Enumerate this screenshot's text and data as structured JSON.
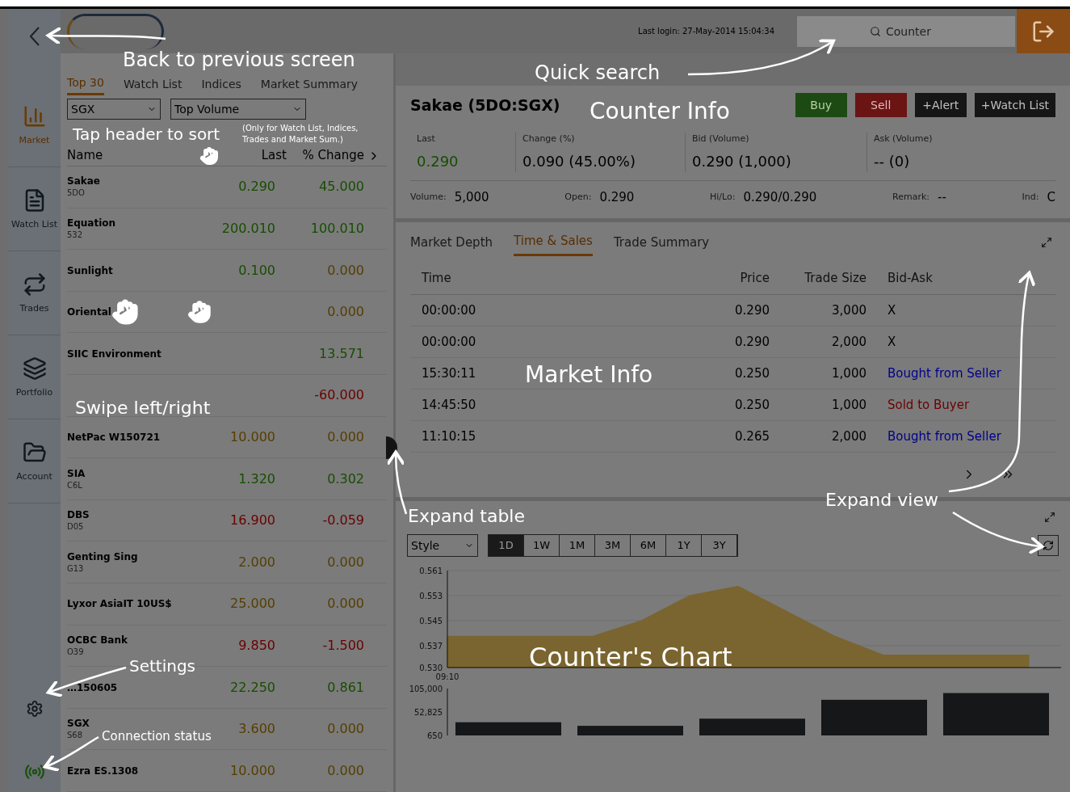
{
  "sidebar": {
    "items": [
      {
        "label": "Market",
        "kind": "market",
        "selected": true
      },
      {
        "label": "Watch List",
        "kind": "watchlist",
        "selected": false
      },
      {
        "label": "Trades",
        "kind": "trades",
        "selected": false
      },
      {
        "label": "Portfolio",
        "kind": "portfolio",
        "selected": false
      },
      {
        "label": "Account",
        "kind": "account",
        "selected": false
      }
    ]
  },
  "header": {
    "last_login": "Last login: 27-May-2014 15:04:34",
    "search": {
      "placeholder": "Counter"
    }
  },
  "watch_panel": {
    "tabs": [
      {
        "label": "Top 30",
        "selected": true
      },
      {
        "label": "Watch List",
        "selected": false
      },
      {
        "label": "Indices",
        "selected": false
      },
      {
        "label": "Market Summary",
        "selected": false
      }
    ],
    "exchange": "SGX",
    "sort": "Top Volume",
    "columns": [
      "Name",
      "Last",
      "% Change"
    ],
    "rows": [
      {
        "name": "Sakae",
        "code": "5DO",
        "last": {
          "text": "0.290",
          "color": "#174d00"
        },
        "change": {
          "text": "45.000",
          "color": "#174d00"
        }
      },
      {
        "name": "Equation",
        "code": "532",
        "last": {
          "text": "200.010",
          "color": "#174d00"
        },
        "change": {
          "text": "100.010",
          "color": "#174d00"
        }
      },
      {
        "name": "Sunlight",
        "last": {
          "text": "0.100",
          "color": "#174d00"
        },
        "change": {
          "text": "0.000",
          "color": "#553e00"
        }
      },
      {
        "name": "Oriental",
        "change": {
          "text": "0.000",
          "color": "#553e00"
        }
      },
      {
        "name": "SIIC Environment",
        "change": {
          "text": "13.571",
          "color": "#174d00"
        }
      },
      {
        "change": {
          "text": "-60.000",
          "color": "#6a0000"
        }
      },
      {
        "name": "NetPac W150721",
        "last": {
          "text": "10.000",
          "color": "#553e00"
        },
        "change": {
          "text": "0.000",
          "color": "#553e00"
        }
      },
      {
        "name": "SIA",
        "code": "C6L",
        "last": {
          "text": "1.320",
          "color": "#174d00"
        },
        "change": {
          "text": "0.302",
          "color": "#174d00"
        }
      },
      {
        "name": "DBS",
        "code": "D05",
        "last": {
          "text": "16.900",
          "color": "#6a0000"
        },
        "change": {
          "text": "-0.059",
          "color": "#6a0000"
        }
      },
      {
        "name": "Genting Sing",
        "code": "G13",
        "last": {
          "text": "2.000",
          "color": "#553e00"
        },
        "change": {
          "text": "0.000",
          "color": "#553e00"
        }
      },
      {
        "name": "Lyxor AsiaIT 10US$",
        "last": {
          "text": "25.000",
          "color": "#553e00"
        },
        "change": {
          "text": "0.000",
          "color": "#553e00"
        }
      },
      {
        "name": "OCBC Bank",
        "code": "O39",
        "last": {
          "text": "9.850",
          "color": "#6a0000"
        },
        "change": {
          "text": "-1.500",
          "color": "#6a0000"
        }
      },
      {
        "name": "…150605",
        "last": {
          "text": "22.250",
          "color": "#174d00"
        },
        "change": {
          "text": "0.861",
          "color": "#174d00"
        }
      },
      {
        "name": "SGX",
        "code": "S68",
        "last": {
          "text": "3.600",
          "color": "#553e00"
        },
        "change": {
          "text": "0.000",
          "color": "#553e00"
        }
      },
      {
        "name": "Ezra ES.1308",
        "last": {
          "text": "10.000",
          "color": "#553e00"
        },
        "change": {
          "text": "0.000",
          "color": "#553e00"
        }
      }
    ]
  },
  "counter": {
    "title": "Sakae (5DO:SGX)",
    "actions": [
      {
        "label": "Buy",
        "kind": "buy"
      },
      {
        "label": "Sell",
        "kind": "sell"
      },
      {
        "label": "+Alert",
        "kind": "plain"
      },
      {
        "label": "+Watch List",
        "kind": "plain"
      }
    ],
    "quotes": [
      {
        "label": "Last",
        "value": "0.290",
        "color": "#174d00"
      },
      {
        "label": "Change (%)",
        "value": "0.090 (45.00%)",
        "color": "#000000"
      },
      {
        "label": "Bid (Volume)",
        "value": "0.290 (1,000)",
        "color": "#000000"
      },
      {
        "label": "Ask (Volume)",
        "value": "-- (0)",
        "color": "#000000"
      }
    ],
    "stats": [
      {
        "label": "Volume:",
        "value": "5,000"
      },
      {
        "label": "Open:",
        "value": "0.290"
      },
      {
        "label": "Hi/Lo:",
        "value": "0.290/0.290"
      },
      {
        "label": "Remark:",
        "value": "--"
      },
      {
        "label": "Ind:",
        "value": "C"
      }
    ]
  },
  "market_info": {
    "tabs": [
      {
        "label": "Market Depth",
        "selected": false
      },
      {
        "label": "Time & Sales",
        "selected": true
      },
      {
        "label": "Trade Summary",
        "selected": false
      }
    ],
    "columns": [
      "Time",
      "Price",
      "Trade Size",
      "Bid-Ask"
    ],
    "rows": [
      {
        "time": "00:00:00",
        "price": "0.290",
        "size": "3,000",
        "bid_ask": {
          "text": "X",
          "kind": "none"
        }
      },
      {
        "time": "00:00:00",
        "price": "0.290",
        "size": "2,000",
        "bid_ask": {
          "text": "X",
          "kind": "none"
        }
      },
      {
        "time": "15:30:11",
        "price": "0.250",
        "size": "1,000",
        "bid_ask": {
          "text": "Bought from Seller",
          "kind": "buy"
        }
      },
      {
        "time": "14:45:50",
        "price": "0.250",
        "size": "1,000",
        "bid_ask": {
          "text": "Sold to Buyer",
          "kind": "sell"
        }
      },
      {
        "time": "11:10:15",
        "price": "0.265",
        "size": "2,000",
        "bid_ask": {
          "text": "Bought from Seller",
          "kind": "buy"
        }
      }
    ]
  },
  "chart_panel": {
    "style": "Style",
    "ranges": [
      {
        "label": "1D",
        "selected": true
      },
      {
        "label": "1W",
        "selected": false
      },
      {
        "label": "1M",
        "selected": false
      },
      {
        "label": "3M",
        "selected": false
      },
      {
        "label": "6M",
        "selected": false
      },
      {
        "label": "1Y",
        "selected": false
      },
      {
        "label": "3Y",
        "selected": false
      }
    ],
    "price_chart": {
      "start_time": "09:10",
      "chart_data": {
        "type": "area",
        "grid": true,
        "ylim": [
          0.53,
          0.561
        ],
        "yticks": [
          {
            "value": 0.53,
            "label": "0.530"
          },
          {
            "value": 0.537,
            "label": "0.537"
          },
          {
            "value": 0.545,
            "label": "0.545"
          },
          {
            "value": 0.553,
            "label": "0.553"
          },
          {
            "value": 0.561,
            "label": "0.561"
          }
        ],
        "series": [
          {
            "color": "#7a6530",
            "values": [
              0.54,
              0.54,
              0.54,
              0.54,
              0.545,
              0.553,
              0.556,
              0.548,
              0.54,
              0.534,
              0.534,
              0.534,
              0.534
            ]
          }
        ]
      }
    },
    "volume_chart": {
      "chart_data": {
        "type": "bar",
        "categories": [
          null,
          null,
          null,
          null,
          null
        ],
        "ylim": [
          650,
          105000
        ],
        "yticks": [
          {
            "value": 650,
            "label": "650"
          },
          {
            "value": 52825,
            "label": "52,825"
          },
          {
            "value": 105000,
            "label": "105,000"
          }
        ],
        "series": [
          {
            "color": "#151718",
            "values": [
              30000,
              22000,
              38000,
              80000,
              95000
            ]
          }
        ]
      }
    }
  },
  "annotations": [
    {
      "text": "Back to previous screen"
    },
    {
      "text": "Quick search"
    },
    {
      "text": "Counter Info"
    },
    {
      "text": "Tap header to sort"
    },
    {
      "text": "(Only for Watch List, Indices,"
    },
    {
      "text": "Trades and Market Sum.)"
    },
    {
      "text": "Market Info"
    },
    {
      "text": "Swipe left/right"
    },
    {
      "text": "Expand view"
    },
    {
      "text": "Expand table"
    },
    {
      "text": "Settings"
    },
    {
      "text": "Counter's Chart"
    },
    {
      "text": "Connection status"
    }
  ]
}
